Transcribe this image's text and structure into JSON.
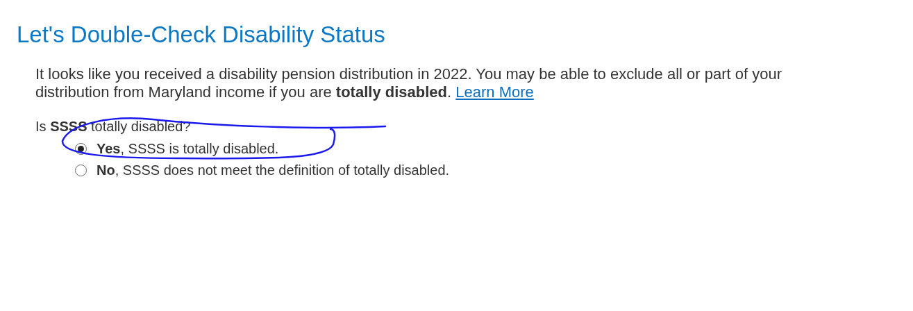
{
  "title": "Let's Double-Check Disability Status",
  "intro": {
    "text": "It looks like you received a disability pension distribution in 2022. You may be able to exclude all or part of your distribution from Maryland income if you are **totally disabled**.",
    "link": "Learn More"
  },
  "question": "Is **SSSS** totally disabled?",
  "options": [
    {
      "label": "**Yes**, SSSS is totally disabled.",
      "selected": true
    },
    {
      "label": "**No**, SSSS does not meet the definition of totally disabled.",
      "selected": false
    }
  ]
}
